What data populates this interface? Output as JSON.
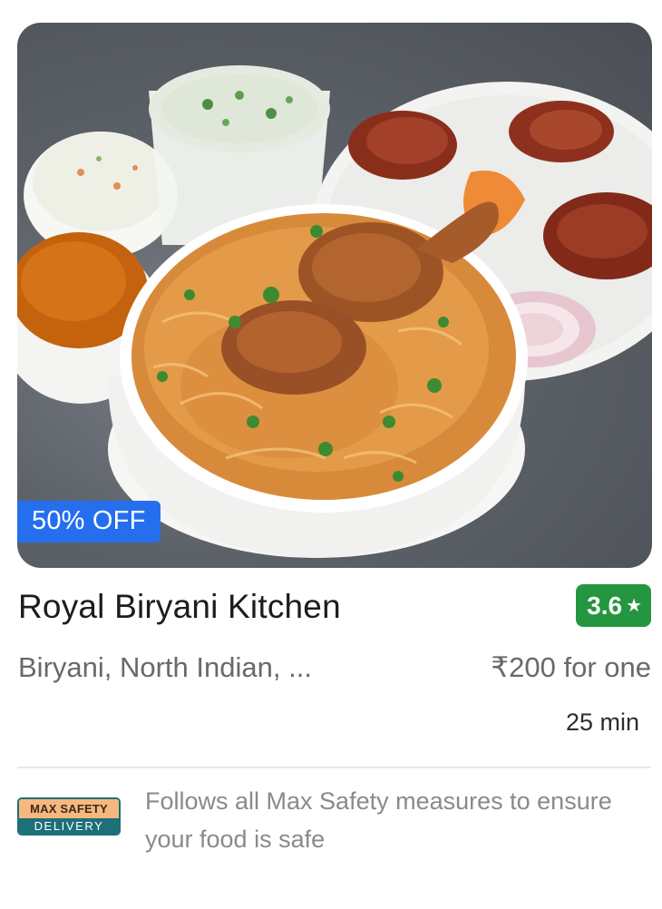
{
  "restaurant": {
    "offer_badge": "50% OFF",
    "name": "Royal Biryani Kitchen",
    "rating": "3.6",
    "cuisines": "Biryani, North Indian, ...",
    "price": "₹200 for one",
    "delivery_time": "25 min"
  },
  "safety": {
    "logo_top": "MAX SAFETY",
    "logo_bottom": "DELIVERY",
    "text": "Follows all Max Safety measures to ensure your food is safe"
  },
  "colors": {
    "offer_badge": "#256fef",
    "rating_badge": "#24963f",
    "safety_logo_teal": "#1d6f78",
    "safety_logo_peach": "#f6b87f"
  },
  "icons": {
    "rating": "star-icon"
  }
}
